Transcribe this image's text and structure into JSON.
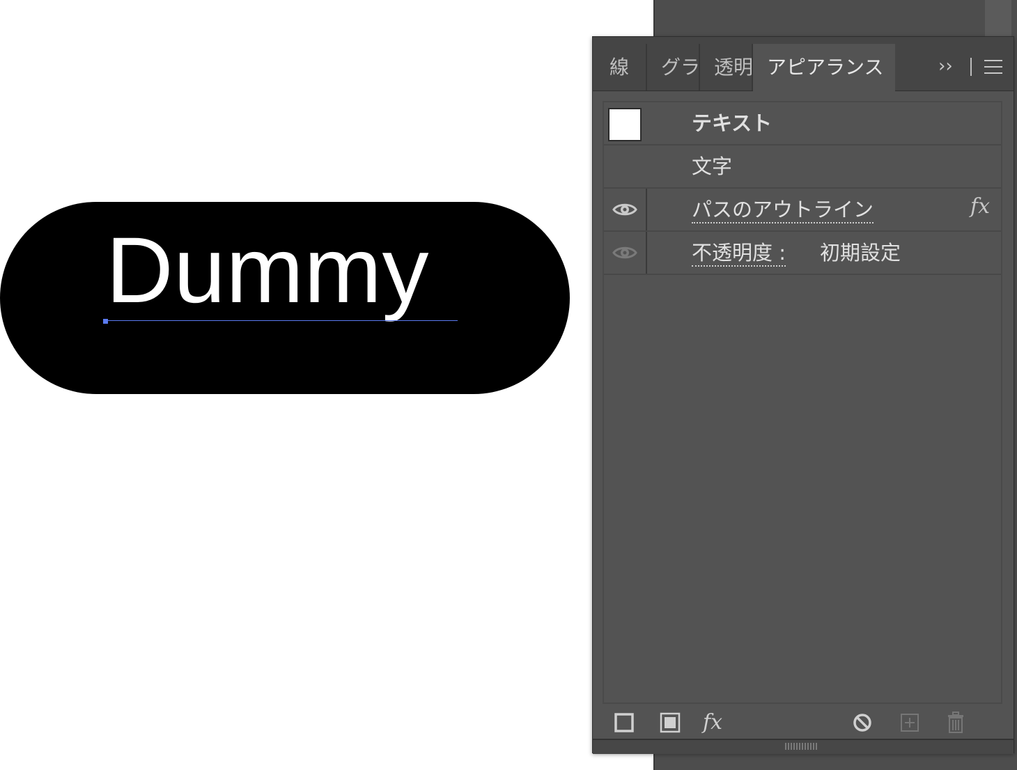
{
  "artboard": {
    "object_text": "Dummy",
    "fill_color": "#000000",
    "text_color": "#ffffff",
    "selection_color": "#5b7bf0"
  },
  "panel": {
    "tabs": [
      {
        "label": "線",
        "active": false
      },
      {
        "label": "グラ",
        "active": false
      },
      {
        "label": "透明",
        "active": false
      },
      {
        "label": "アピアランス",
        "active": true
      }
    ],
    "more_icon": "››",
    "menu_icon": "hamburger-icon",
    "rows": {
      "header": {
        "label": "テキスト",
        "swatch": "#ffffff"
      },
      "character": {
        "label": "文字"
      },
      "outline": {
        "label": "パスのアウトライン",
        "visible": true,
        "fx_badge": "fx"
      },
      "opacity": {
        "label": "不透明度 :",
        "value": "初期設定",
        "visible": true
      }
    },
    "toolbar": {
      "add_stroke_icon": "add-stroke-icon",
      "add_fill_icon": "add-fill-icon",
      "fx_label": "fx",
      "clear_icon": "clear-appearance-icon",
      "duplicate_icon": "duplicate-item-icon",
      "delete_icon": "trash-icon"
    }
  },
  "colors": {
    "panel_bg": "#535353",
    "tabbar_bg": "#454545",
    "text": "#e0e0e0"
  }
}
